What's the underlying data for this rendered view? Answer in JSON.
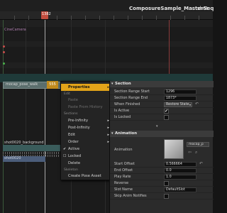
{
  "header": {
    "sequence_title": "ComposureSample_MasterSeq",
    "separator": "›",
    "sub_title": "shot",
    "playhead_frame": "1382",
    "cine_camera_label": "CineCamera"
  },
  "tracks": {
    "section_name": "mocap_pose_walk",
    "section_frame": "555",
    "background_label": "shot0020_background",
    "shot_label": "shot0020"
  },
  "context_menu": {
    "properties": "Properties",
    "edit_heading": "Edit",
    "paste": "Paste",
    "paste_history": "Paste From History",
    "sections_heading": "Sections",
    "pre_infinity": "Pre-Infinity",
    "post_infinity": "Post-Infinity",
    "edit": "Edit",
    "order": "Order",
    "active": "Active",
    "locked": "Locked",
    "delete": "Delete",
    "skeleton_heading": "Skeleton",
    "create_pose_asset": "Create Pose Asset"
  },
  "properties": {
    "section_header": "Section",
    "range_start_label": "Section Range Start",
    "range_start_value": "1296",
    "range_end_label": "Section Range End",
    "range_end_value": "1873*",
    "when_finished_label": "When Finished",
    "when_finished_value": "Restore State",
    "is_active_label": "Is Active",
    "is_locked_label": "Is Locked",
    "animation_header": "Animation",
    "animation_label": "Animation",
    "animation_asset": "mocap_p",
    "start_offset_label": "Start Offset",
    "start_offset_value": "0.566664",
    "end_offset_label": "End Offset",
    "end_offset_value": "0.0",
    "play_rate_label": "Play Rate",
    "play_rate_value": "1.0",
    "reverse_label": "Reverse",
    "slot_name_label": "Slot Name",
    "slot_name_value": "DefaultSlot",
    "skip_notifies_label": "Skip Anim Notifies"
  }
}
